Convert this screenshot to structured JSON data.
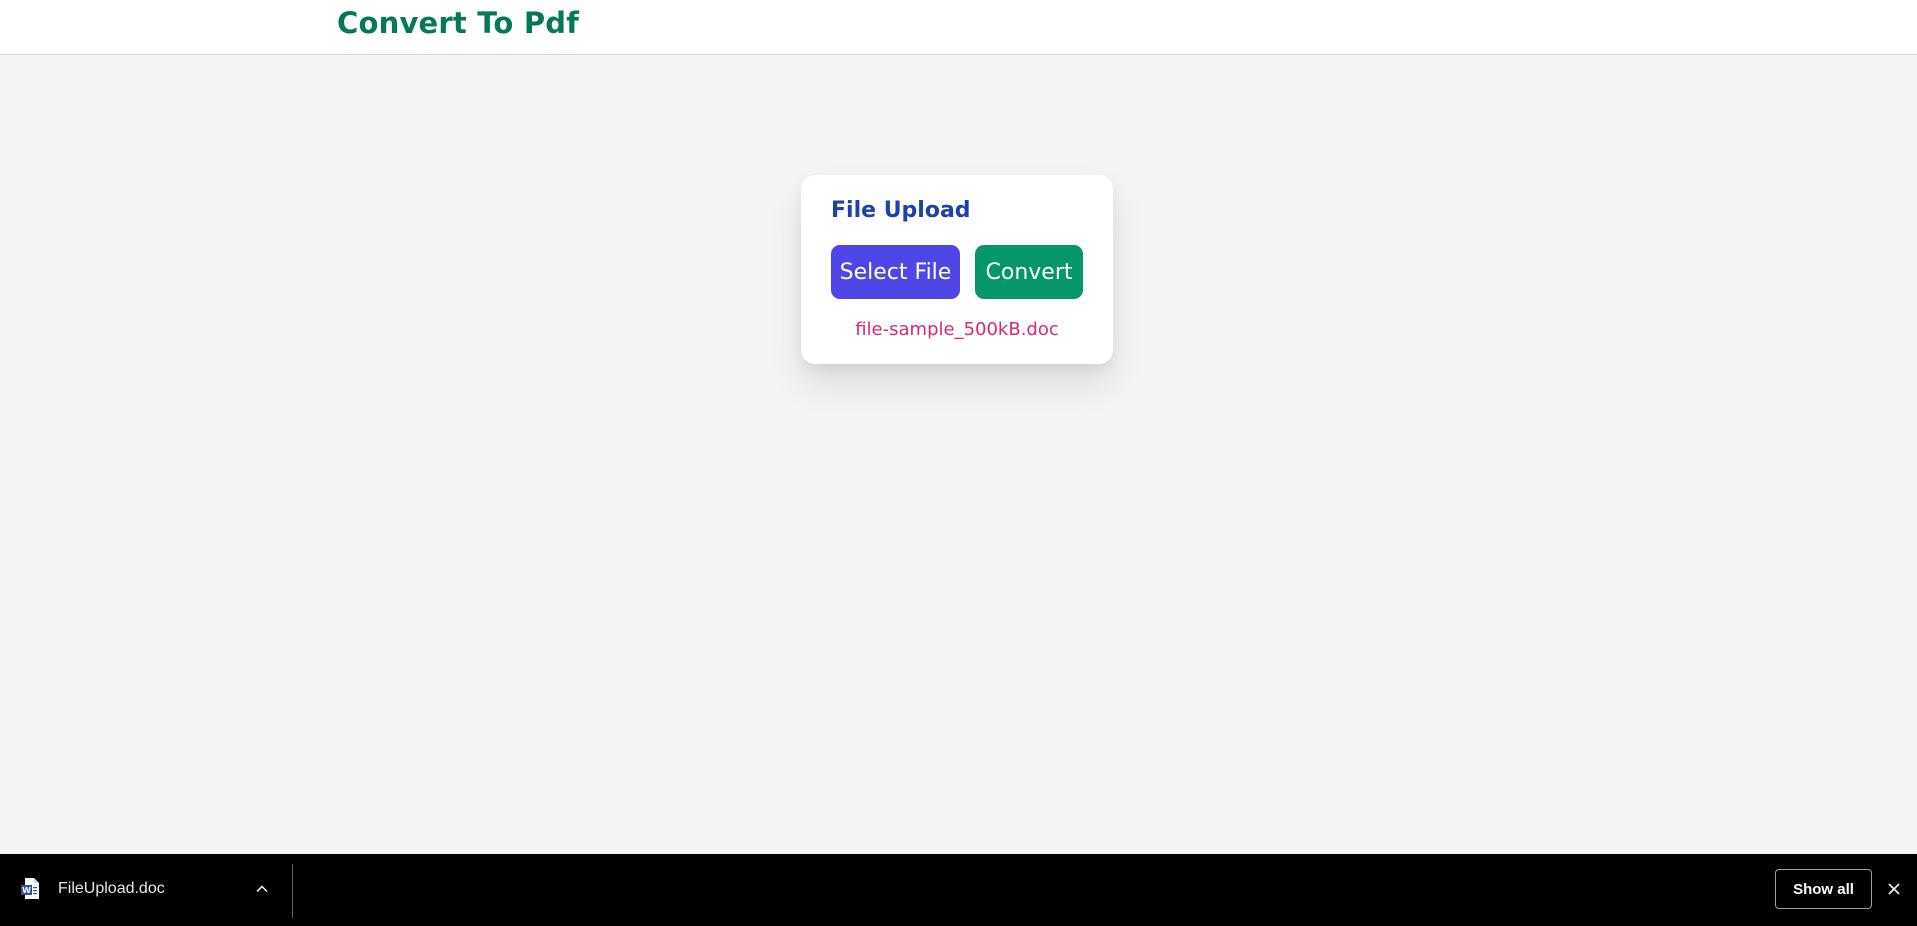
{
  "header": {
    "title": "Convert To Pdf",
    "title_color": "#047857"
  },
  "upload_card": {
    "title": "File Upload",
    "select_button_label": "Select File",
    "convert_button_label": "Convert",
    "selected_file_name": "file-sample_500kB.doc",
    "colors": {
      "title": "#1e40af",
      "select_button": "#4f46e5",
      "convert_button": "#059669",
      "file_name": "#db2777"
    }
  },
  "download_bar": {
    "items": [
      {
        "file_name": "FileUpload.doc",
        "icon": "word-document-icon"
      }
    ],
    "show_all_label": "Show all",
    "close_icon": "close-icon"
  }
}
